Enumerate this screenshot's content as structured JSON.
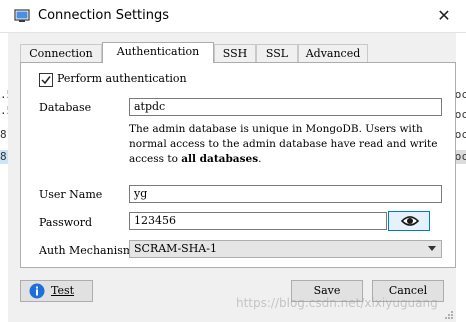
{
  "window": {
    "title": "Connection Settings",
    "close_glyph": "✕"
  },
  "background": {
    "left_fragments": [
      ".5",
      ".5",
      "8",
      "8"
    ],
    "right_fragments": [
      "oc",
      "oc",
      "oc",
      "oc"
    ]
  },
  "tabs": [
    {
      "label": "Connection",
      "active": false
    },
    {
      "label": "Authentication",
      "active": true
    },
    {
      "label": "SSH",
      "active": false
    },
    {
      "label": "SSL",
      "active": false
    },
    {
      "label": "Advanced",
      "active": false
    }
  ],
  "auth": {
    "perform_auth_label": "Perform authentication",
    "perform_auth_checked": true,
    "database_label": "Database",
    "database_value": "atpdc",
    "description_prefix": "The admin database is unique in MongoDB. Users with normal access to the admin database have read and write access to ",
    "description_bold": "all databases",
    "description_suffix": ".",
    "username_label": "User Name",
    "username_value": "yg",
    "password_label": "Password",
    "password_value": "123456",
    "mechanism_label": "Auth Mechanism",
    "mechanism_value": "SCRAM-SHA-1"
  },
  "footer": {
    "test_label": "Test",
    "save_label": "Save",
    "cancel_label": "Cancel",
    "watermark": "https://blog.csdn.net/xixiyuguang"
  },
  "icons": {
    "app": "window-icon",
    "close": "close-icon",
    "check": "checkmark-icon",
    "eye": "eye-icon",
    "info": "info-icon",
    "dropdown": "chevron-down-icon"
  },
  "colors": {
    "accent": "#0078d7",
    "info_icon": "#1e6fd9",
    "panel": "#ffffff",
    "chrome": "#f0f0f0"
  }
}
